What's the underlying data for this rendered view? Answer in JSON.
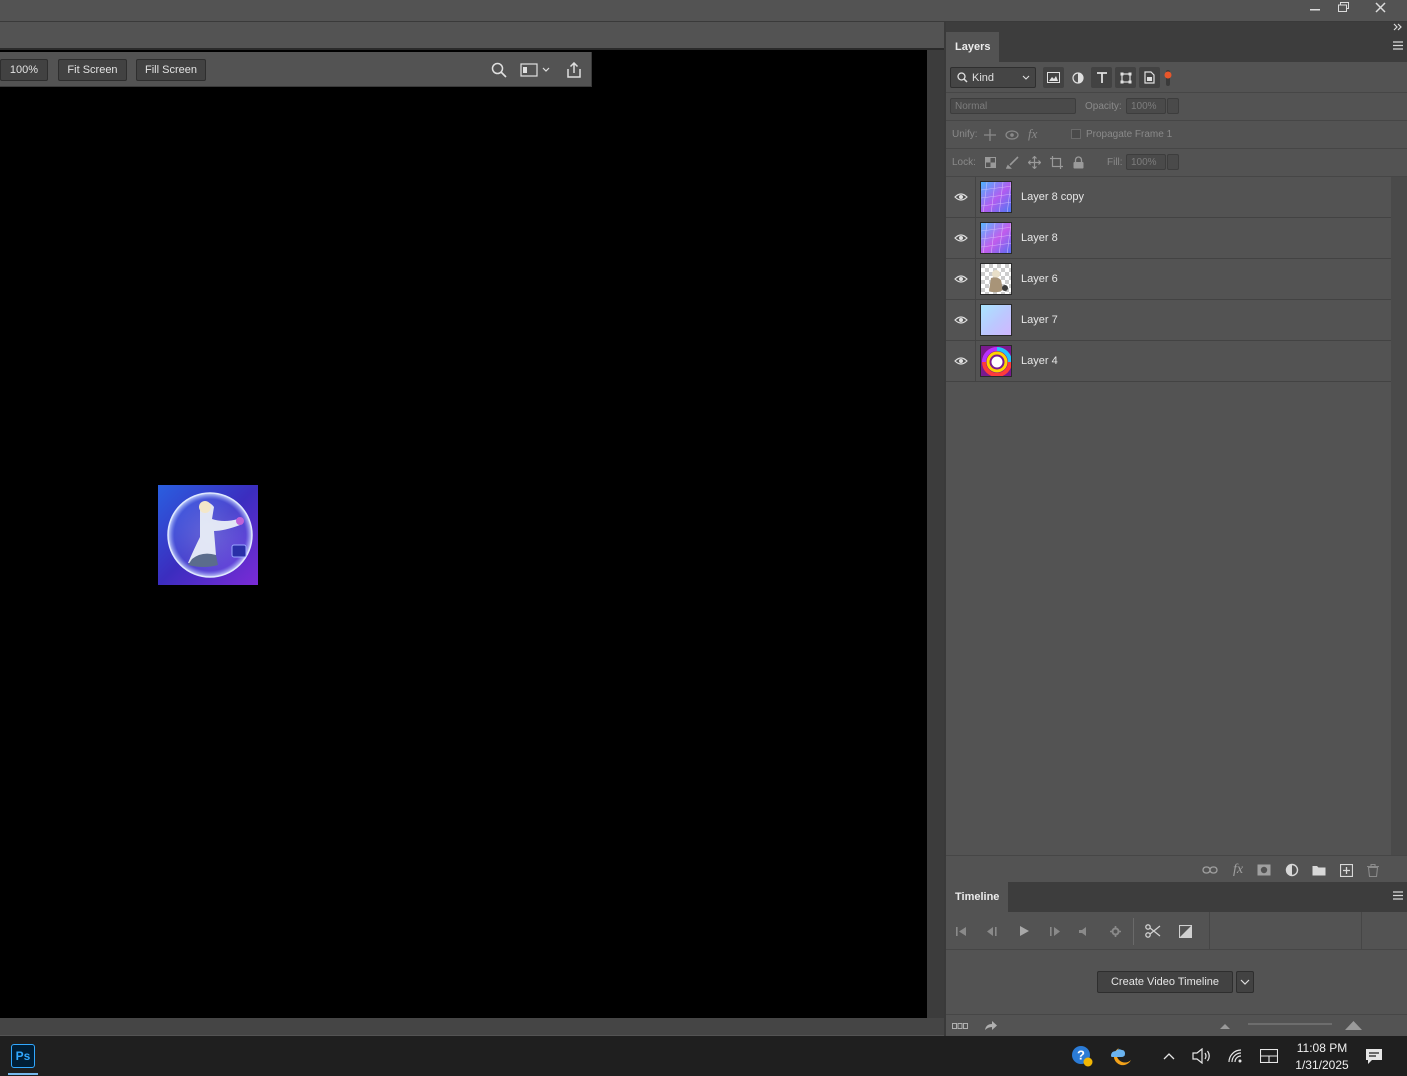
{
  "options_bar": {
    "zoom_value": "100%",
    "fit_screen_label": "Fit Screen",
    "fill_screen_label": "Fill Screen"
  },
  "layers_panel": {
    "title": "Layers",
    "filter_kind": "Kind",
    "blend_mode": "Normal",
    "opacity_label": "Opacity:",
    "opacity_value": "100%",
    "unify_label": "Unify:",
    "propagate_label": "Propagate Frame 1",
    "lock_label": "Lock:",
    "fill_label": "Fill:",
    "fill_value": "100%",
    "layers": [
      {
        "name": "Layer 8 copy",
        "visible": true,
        "thumb": "gradient-scales"
      },
      {
        "name": "Layer 8",
        "visible": true,
        "thumb": "gradient-scales"
      },
      {
        "name": "Layer 6",
        "visible": true,
        "thumb": "transparent-figure"
      },
      {
        "name": "Layer 7",
        "visible": true,
        "thumb": "soft-gradient"
      },
      {
        "name": "Layer 4",
        "visible": true,
        "thumb": "color-ring"
      }
    ]
  },
  "timeline_panel": {
    "title": "Timeline",
    "create_button_label": "Create Video Timeline"
  },
  "taskbar": {
    "time": "11:08 PM",
    "date": "1/31/2025",
    "app_icon_label": "Ps"
  },
  "colors": {
    "ui_bg": "#535353",
    "panel_dark": "#3d3d3d",
    "canvas_bg": "#000000",
    "taskbar_bg": "#1f1f1f",
    "ps_accent": "#31a8ff"
  }
}
